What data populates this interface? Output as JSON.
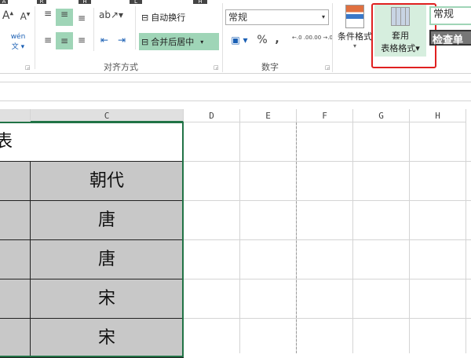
{
  "keytips": [
    "A",
    "R",
    "H",
    "L",
    "H"
  ],
  "ribbon": {
    "alignment_group": "对齐方式",
    "wrap_text": "自动换行",
    "merge_center": "合并后居中",
    "number_group": "数字",
    "number_format": "常规",
    "percent": "%",
    "comma": ",",
    "increase_decimal": "←.0 .00",
    "decrease_decimal": ".00 →.0",
    "conditional_format": "条件格式",
    "format_as_table_line1": "套用",
    "format_as_table_line2": "表格格式",
    "style_normal": "常规",
    "style_check": "检查单"
  },
  "columns": [
    "C",
    "D",
    "E",
    "F",
    "G",
    "H"
  ],
  "cells": {
    "title_partial": "表",
    "header": "朝代",
    "rows": [
      "唐",
      "唐",
      "宋",
      "宋"
    ]
  },
  "colors": {
    "accent": "#217346",
    "highlight": "#9fd5b7",
    "callout": "#e02020"
  }
}
